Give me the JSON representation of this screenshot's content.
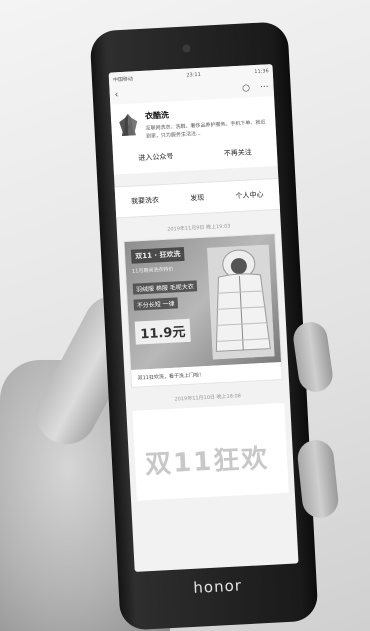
{
  "statusbar": {
    "carrier": "中国移动",
    "time": "23:11",
    "right_info": "23:11",
    "battery": "11:36"
  },
  "topbar": {
    "back_icon": "back-arrow-icon",
    "search_icon": "search-icon",
    "more_icon": "more-icon"
  },
  "profile": {
    "name": "衣酷洗",
    "description": "互联网洗衣、洗鞋、奢侈品养护服务。手机下单、就近到家，只为服务生活注..."
  },
  "actions": {
    "enter": "进入公众号",
    "unfollow": "不再关注"
  },
  "menu": {
    "item1": "我要洗衣",
    "item2": "发现",
    "item3": "个人中心"
  },
  "messages": [
    {
      "timestamp": "2019年11月9日 晚上19:03",
      "banner_title": "双11 · 狂欢洗",
      "banner_sub": "11月期间洗衣特价",
      "banner_line1": "羽绒服 棉服 毛呢大衣",
      "banner_line2": "不分长短 一律",
      "price": "11.9元",
      "caption": "双11狂欢洗，看干洗上门啦！"
    },
    {
      "timestamp": "2019年11月10日 晚上18:08",
      "banner_text": "双11狂欢"
    }
  ],
  "device": {
    "brand": "honor"
  }
}
